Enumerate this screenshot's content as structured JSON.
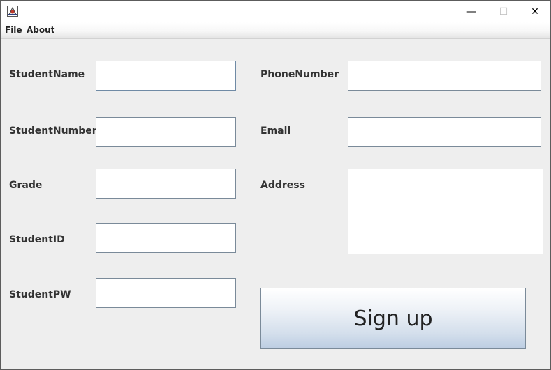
{
  "window": {
    "icon": "java-app-icon",
    "minimize_glyph": "—",
    "maximize_glyph": "☐",
    "close_glyph": "✕"
  },
  "menu": {
    "file": "File",
    "about": "About"
  },
  "form": {
    "student_name_label": "StudentName",
    "student_name_value": "",
    "student_number_label": "StudentNumber",
    "student_number_value": "",
    "grade_label": "Grade",
    "grade_value": "",
    "student_id_label": "StudentID",
    "student_id_value": "",
    "student_pw_label": "StudentPW",
    "student_pw_value": "",
    "phone_number_label": "PhoneNumber",
    "phone_number_value": "",
    "email_label": "Email",
    "email_value": "",
    "address_label": "Address",
    "address_value": ""
  },
  "actions": {
    "signup_label": "Sign up"
  }
}
